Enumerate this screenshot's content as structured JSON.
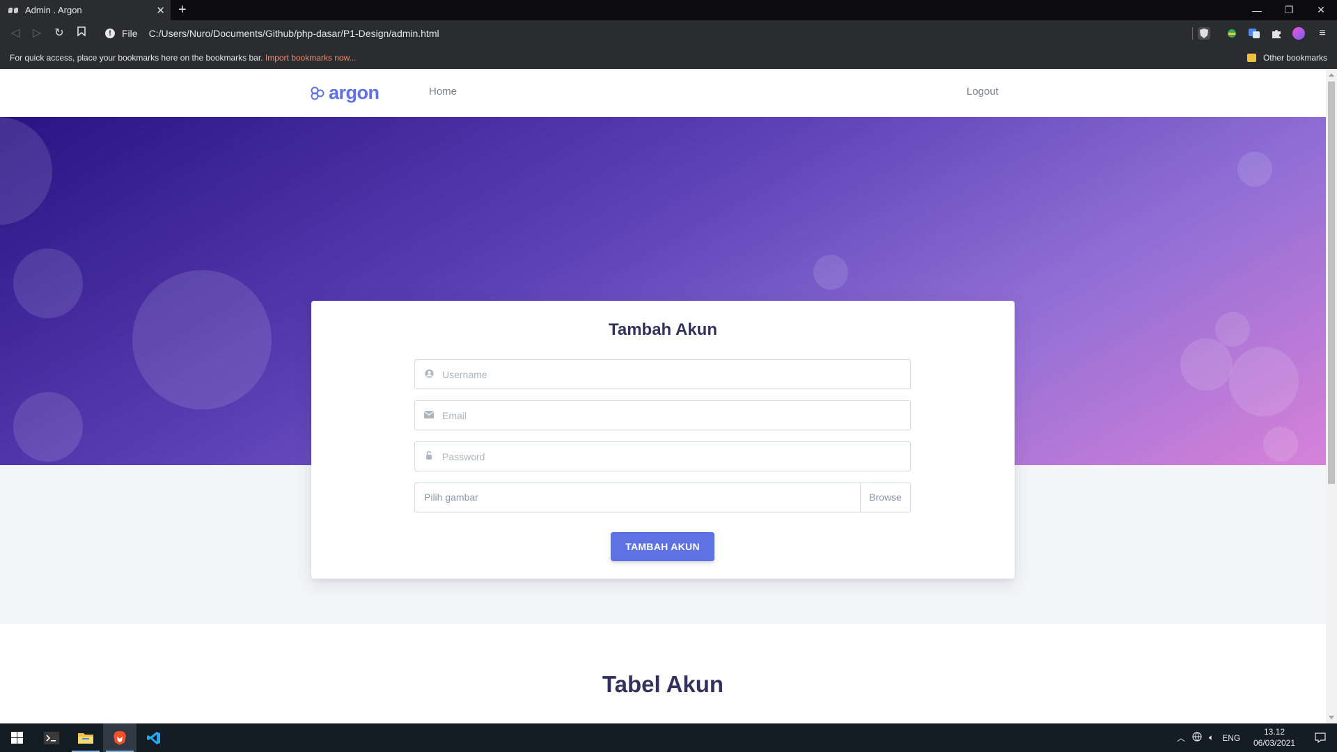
{
  "browser": {
    "tab_title": "Admin . Argon",
    "address_scheme": "File",
    "address_url": "C:/Users/Nuro/Documents/Github/php-dasar/P1-Design/admin.html",
    "bookmarks_message": "For quick access, place your bookmarks here on the bookmarks bar.",
    "bookmarks_import": "Import bookmarks now...",
    "other_bookmarks": "Other bookmarks"
  },
  "navbar": {
    "brand": "argon",
    "home": "Home",
    "logout": "Logout"
  },
  "form": {
    "title": "Tambah Akun",
    "username_placeholder": "Username",
    "email_placeholder": "Email",
    "password_placeholder": "Password",
    "file_label": "Pilih gambar",
    "browse_label": "Browse",
    "submit_label": "TAMBAH AKUN"
  },
  "table": {
    "title": "Tabel Akun"
  },
  "taskbar": {
    "language": "ENG",
    "time": "13.12",
    "date": "06/03/2021"
  },
  "colors": {
    "primary": "#5e72e4",
    "heading": "#32325d"
  }
}
